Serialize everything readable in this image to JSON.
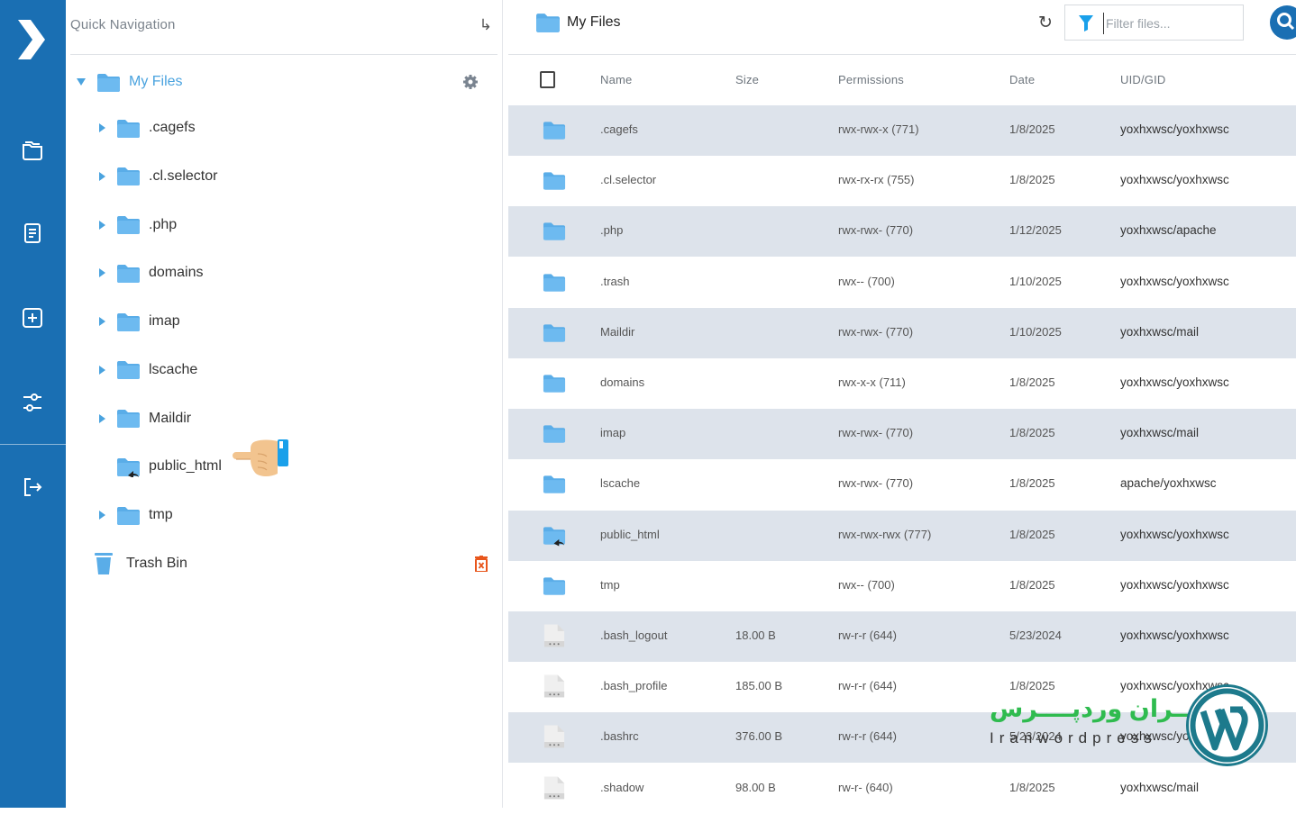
{
  "rail": {
    "items": [
      {
        "name": "files-nav",
        "icon": "folder-icon"
      },
      {
        "name": "editor-nav",
        "icon": "document-icon"
      },
      {
        "name": "new-nav",
        "icon": "add-box-icon"
      },
      {
        "name": "settings-nav",
        "icon": "sliders-icon"
      },
      {
        "name": "logout-nav",
        "icon": "logout-icon"
      }
    ]
  },
  "quick_nav": {
    "placeholder": "Quick Navigation",
    "enter_glyph": "↳"
  },
  "tree": {
    "root": "My Files",
    "children": [
      ".cagefs",
      ".cl.selector",
      ".php",
      "domains",
      "imap",
      "lscache",
      "Maildir",
      "public_html",
      "tmp"
    ],
    "trash": "Trash Bin"
  },
  "toolbar": {
    "breadcrumb": "My Files",
    "refresh_glyph": "↻",
    "filter_placeholder": "Filter files..."
  },
  "table": {
    "headers": {
      "name": "Name",
      "size": "Size",
      "permissions": "Permissions",
      "date": "Date",
      "uid": "UID/GID"
    },
    "rows": [
      {
        "type": "folder",
        "name": ".cagefs",
        "size": "",
        "perm": "rwx-rwx-x (771)",
        "date": "1/8/2025",
        "uid": "yoxhxwsc/yoxhxwsc"
      },
      {
        "type": "folder",
        "name": ".cl.selector",
        "size": "",
        "perm": "rwx-rx-rx (755)",
        "date": "1/8/2025",
        "uid": "yoxhxwsc/yoxhxwsc"
      },
      {
        "type": "folder",
        "name": ".php",
        "size": "",
        "perm": "rwx-rwx- (770)",
        "date": "1/12/2025",
        "uid": "yoxhxwsc/apache"
      },
      {
        "type": "folder",
        "name": ".trash",
        "size": "",
        "perm": "rwx-- (700)",
        "date": "1/10/2025",
        "uid": "yoxhxwsc/yoxhxwsc"
      },
      {
        "type": "folder",
        "name": "Maildir",
        "size": "",
        "perm": "rwx-rwx- (770)",
        "date": "1/10/2025",
        "uid": "yoxhxwsc/mail"
      },
      {
        "type": "folder",
        "name": "domains",
        "size": "",
        "perm": "rwx-x-x (711)",
        "date": "1/8/2025",
        "uid": "yoxhxwsc/yoxhxwsc"
      },
      {
        "type": "folder",
        "name": "imap",
        "size": "",
        "perm": "rwx-rwx- (770)",
        "date": "1/8/2025",
        "uid": "yoxhxwsc/mail"
      },
      {
        "type": "folder",
        "name": "lscache",
        "size": "",
        "perm": "rwx-rwx- (770)",
        "date": "1/8/2025",
        "uid": "apache/yoxhxwsc"
      },
      {
        "type": "link",
        "name": "public_html",
        "size": "",
        "perm": "rwx-rwx-rwx (777)",
        "date": "1/8/2025",
        "uid": "yoxhxwsc/yoxhxwsc"
      },
      {
        "type": "folder",
        "name": "tmp",
        "size": "",
        "perm": "rwx-- (700)",
        "date": "1/8/2025",
        "uid": "yoxhxwsc/yoxhxwsc"
      },
      {
        "type": "file",
        "name": ".bash_logout",
        "size": "18.00 B",
        "perm": "rw-r-r (644)",
        "date": "5/23/2024",
        "uid": "yoxhxwsc/yoxhxwsc"
      },
      {
        "type": "file",
        "name": ".bash_profile",
        "size": "185.00 B",
        "perm": "rw-r-r (644)",
        "date": "1/8/2025",
        "uid": "yoxhxwsc/yoxhxwsc"
      },
      {
        "type": "file",
        "name": ".bashrc",
        "size": "376.00 B",
        "perm": "rw-r-r (644)",
        "date": "5/23/2024",
        "uid": "yoxhxwsc/yoxhxwsc"
      },
      {
        "type": "file",
        "name": ".shadow",
        "size": "98.00 B",
        "perm": "rw-r- (640)",
        "date": "1/8/2025",
        "uid": "yoxhxwsc/mail"
      }
    ]
  },
  "watermark": {
    "fa": "ایـــران وردپــــرس",
    "en": "Iranwordpress"
  },
  "colors": {
    "rail": "#1a6fb3",
    "folder": "#5aade8",
    "accent": "#4aa3df",
    "row_alt": "#dde3eb",
    "trash_delete": "#e8561c"
  }
}
